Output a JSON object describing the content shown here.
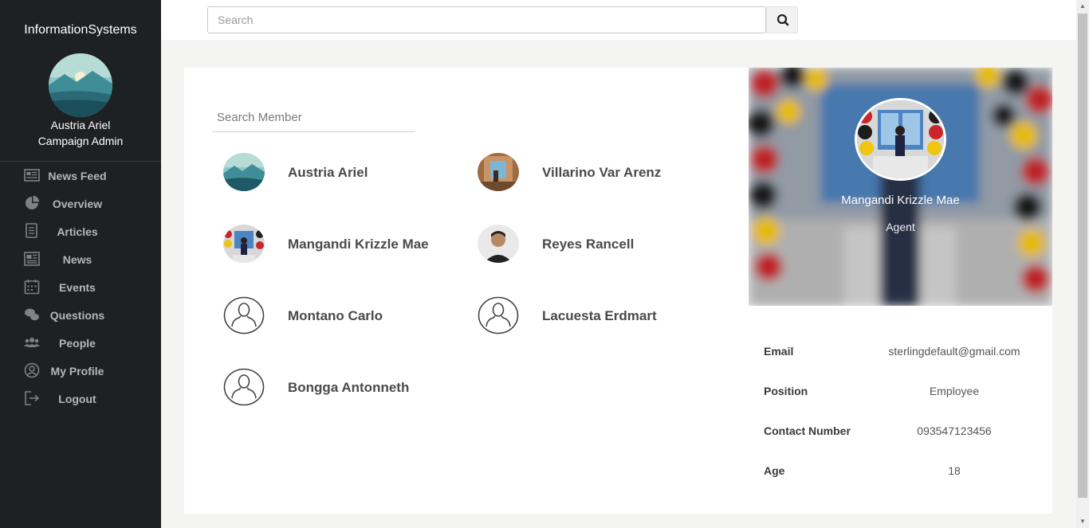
{
  "app": {
    "brand": "InformationSystems"
  },
  "user": {
    "name": "Austria Ariel",
    "role": "Campaign Admin"
  },
  "sidebar": {
    "items": [
      {
        "label": "News Feed",
        "icon": "newspaper-icon"
      },
      {
        "label": "Overview",
        "icon": "pie-chart-icon"
      },
      {
        "label": "Articles",
        "icon": "document-icon"
      },
      {
        "label": "News",
        "icon": "news-icon"
      },
      {
        "label": "Events",
        "icon": "calendar-icon"
      },
      {
        "label": "Questions",
        "icon": "chat-bubbles-icon"
      },
      {
        "label": "People",
        "icon": "people-icon"
      },
      {
        "label": "My Profile",
        "icon": "user-circle-icon"
      },
      {
        "label": "Logout",
        "icon": "logout-icon"
      }
    ]
  },
  "topbar": {
    "search_placeholder": "Search",
    "search_icon": "search-icon"
  },
  "members": {
    "search_placeholder": "Search Member",
    "list": [
      {
        "name": "Austria Ariel",
        "avatar": "landscape-photo"
      },
      {
        "name": "Villarino Var Arenz",
        "avatar": "photo"
      },
      {
        "name": "Mangandi Krizzle Mae",
        "avatar": "photo"
      },
      {
        "name": "Reyes Rancell",
        "avatar": "photo"
      },
      {
        "name": "Montano Carlo",
        "avatar": "default-user-icon"
      },
      {
        "name": "Lacuesta Erdmart",
        "avatar": "default-user-icon"
      },
      {
        "name": "Bongga Antonneth",
        "avatar": "default-user-icon"
      }
    ]
  },
  "profile": {
    "name": "Mangandi Krizzle Mae",
    "role": "Agent",
    "details": [
      {
        "label": "Email",
        "value": "sterlingdefault@gmail.com"
      },
      {
        "label": "Position",
        "value": "Employee"
      },
      {
        "label": "Contact Number",
        "value": "093547123456"
      },
      {
        "label": "Age",
        "value": "18"
      }
    ]
  },
  "colors": {
    "sidebar_bg": "#1e2123",
    "page_bg": "#f4f4f2",
    "nav_text": "#b4b6b8"
  }
}
